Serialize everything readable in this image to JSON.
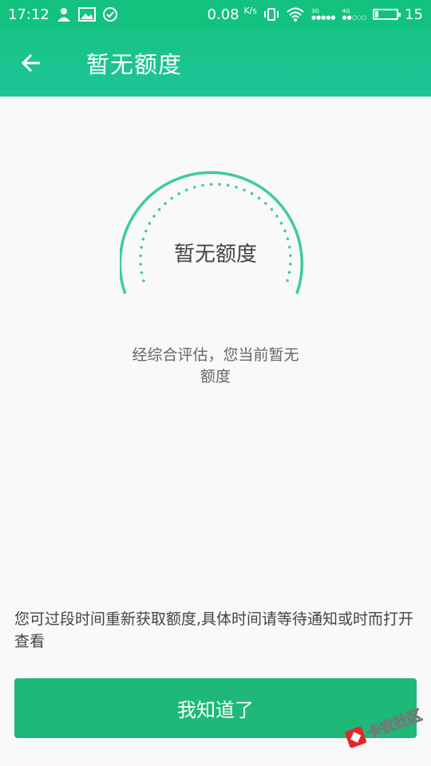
{
  "status_bar": {
    "time": "17:12",
    "net_speed_value": "0.08",
    "net_speed_unit": "K/s",
    "sim1_label": "3G",
    "sim2_label": "4G",
    "battery_level": "15",
    "icons": [
      "person-icon",
      "image-icon",
      "check-circle-icon",
      "vibrate-icon",
      "wifi-icon",
      "signal-icon",
      "battery-icon"
    ]
  },
  "app_bar": {
    "back_icon": "arrow-left-icon",
    "title": "暂无额度"
  },
  "gauge": {
    "label": "暂无额度"
  },
  "description": {
    "line1": "经综合评估，您当前暂无",
    "line2": "额度"
  },
  "hint": {
    "text": "您可过段时间重新获取额度,具体时间请等待通知或时而打开查看"
  },
  "button": {
    "label": "我知道了"
  },
  "watermark": {
    "text": "卡农社区"
  },
  "colors": {
    "primary": "#1eb878",
    "status_bar": "#13c27f",
    "gauge_stroke": "#3ecb9b"
  }
}
